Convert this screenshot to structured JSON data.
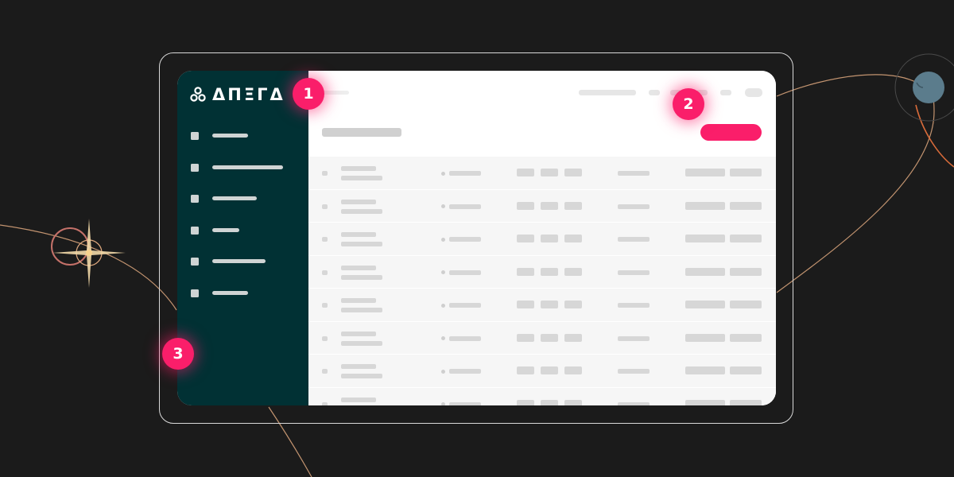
{
  "app": {
    "logo_text": "ΔΠΞΓΔ"
  },
  "colors": {
    "background": "#1b1b1b",
    "sidebar": "#013134",
    "accent": "#fa1e6a",
    "frame_border": "#d9d9d9",
    "orbit_line": "#e0a97f",
    "planet": "#5b7c8c"
  },
  "icons": {
    "logo": "tri-circle-logo-icon",
    "nav": "square-nav-icon"
  },
  "callouts": [
    {
      "number": "1"
    },
    {
      "number": "2"
    },
    {
      "number": "3"
    }
  ]
}
